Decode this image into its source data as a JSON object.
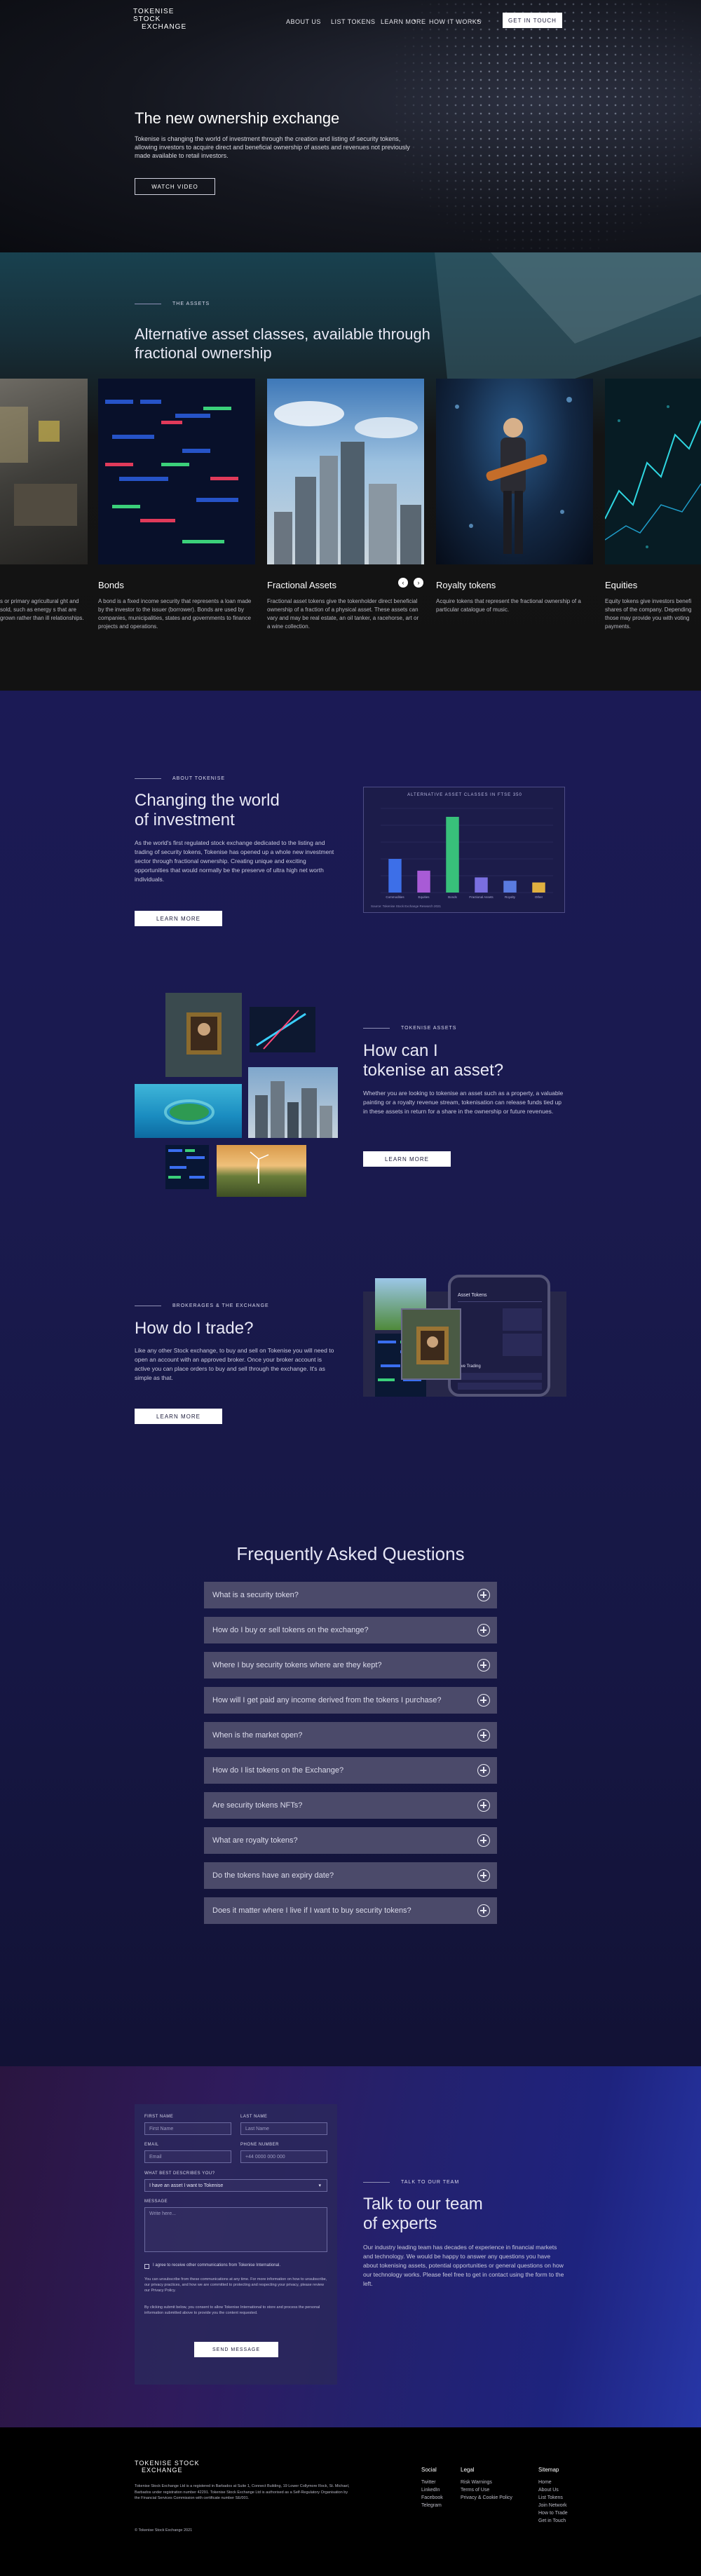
{
  "nav": {
    "logo_line1": "TOKENISE STOCK",
    "logo_line2": "EXCHANGE",
    "links": [
      "ABOUT US",
      "LIST TOKENS",
      "LEARN MORE",
      "HOW IT WORKS"
    ],
    "cta": "GET IN TOUCH"
  },
  "hero": {
    "title": "The new ownership exchange",
    "text": "Tokenise is changing the world of investment through the creation and listing of security tokens, allowing investors to acquire direct and beneficial ownership of assets and revenues not previously made available to retail investors.",
    "button": "WATCH VIDEO"
  },
  "assets": {
    "label": "THE ASSETS",
    "title": "Alternative asset classes, available through fractional ownership",
    "cards": [
      {
        "title": "",
        "desc": "s or primary agricultural ght and sold, such as energy s that are grown rather than ill relationships."
      },
      {
        "title": "Bonds",
        "desc": "A bond is a fixed income security that represents a loan made by the investor to the issuer (borrower). Bonds are used by companies, municipalities, states and governments to finance projects and operations."
      },
      {
        "title": "Fractional Assets",
        "desc": "Fractional asset tokens give the tokenholder direct beneficial ownership of a fraction of a physical asset. These assets can vary and may be real estate, an oil tanker, a racehorse, art or a wine collection."
      },
      {
        "title": "Royalty tokens",
        "desc": "Acquire tokens that represent the fractional ownership of a particular catalogue of music."
      },
      {
        "title": "Equities",
        "desc": "Equity tokens give investors benefi shares of the company. Depending those may provide you with voting payments."
      }
    ],
    "prev_icon": "chevron-left-icon",
    "next_icon": "chevron-right-icon"
  },
  "about": {
    "label": "ABOUT TOKENISE",
    "title_line1": "Changing the world",
    "title_line2": "of investment",
    "text": "As the world's first regulated stock exchange dedicated to the listing and trading of security tokens, Tokenise has opened up a whole new investment sector through fractional ownership. Creating unique and exciting opportunities that would normally be the preserve of ultra high net worth individuals.",
    "button": "LEARN MORE"
  },
  "chart_data": {
    "type": "bar",
    "title": "ALTERNATIVE ASSET CLASSES IN FTSE 350",
    "categories": [
      "Commodities",
      "Equities",
      "Bonds",
      "Fractional Assets",
      "Royalty",
      "Other"
    ],
    "values": [
      20,
      13,
      45,
      9,
      7,
      6
    ],
    "colors": [
      "#3d6fe8",
      "#a85bd6",
      "#38c07a",
      "#7a6fe0",
      "#5a7be0",
      "#e0b040"
    ],
    "ylim": [
      0,
      50
    ],
    "grid": true,
    "footnote": "Source: Tokenise Stock Exchange Research 2021"
  },
  "tokenise": {
    "label": "TOKENISE ASSETS",
    "title_line1": "How can I",
    "title_line2": "tokenise an asset?",
    "text": "Whether you are looking to tokenise an asset such as a property, a valuable painting or a royalty revenue stream, tokenisation can release funds tied up in these assets in return for a share in the ownership or future revenues.",
    "button": "LEARN MORE"
  },
  "trade": {
    "label": "BROKERAGES & THE EXCHANGE",
    "title": "How do I trade?",
    "text": "Like any other Stock exchange, to buy and sell on Tokenise you will need to open an account with an approved broker. Once your broker account is active you can place orders to buy and sell through the exchange. It's as simple as that.",
    "button": "LEARN MORE",
    "phone_header": "Asset Tokens",
    "phone_section": "Live Trading"
  },
  "faq": {
    "title": "Frequently Asked Questions",
    "items": [
      "What is a security token?",
      "How do I buy or sell tokens on the exchange?",
      "Where I buy security tokens where are they kept?",
      "How will I get paid any income derived from the tokens I purchase?",
      "When is the market open?",
      "How do I list tokens on the Exchange?",
      "Are security tokens NFTs?",
      "What are royalty tokens?",
      "Do the tokens have an expiry date?",
      "Does it matter where I live if I want to buy security tokens?"
    ]
  },
  "contact": {
    "first_name_label": "FIRST NAME",
    "first_name_ph": "First Name",
    "last_name_label": "LAST NAME",
    "last_name_ph": "Last Name",
    "email_label": "EMAIL",
    "email_ph": "Email",
    "phone_label": "PHONE NUMBER",
    "phone_ph": "+44 0000 000 000",
    "enquiry_label": "WHAT BEST DESCRIBES YOU?",
    "enquiry_value": "I have an asset I want to Tokenise",
    "message_label": "MESSAGE",
    "message_ph": "Write here...",
    "consent": "I agree to receive other communications from Tokenise International.",
    "privacy1": "You can unsubscribe from these communications at any time. For more information on how to unsubscribe, our privacy practices, and how we are committed to protecting and respecting your privacy, please review our Privacy Policy.",
    "privacy2": "By clicking submit below, you consent to allow Tokenise International to store and process the personal information submitted above to provide you the content requested.",
    "submit": "SEND MESSAGE",
    "label": "TALK TO OUR TEAM",
    "title_line1": "Talk to our team",
    "title_line2": "of experts",
    "text": "Our industry leading team has decades of experience in financial markets and technology. We would be happy to answer any questions you have about tokenising assets, potential opportunities or general questions on how our technology works. Please feel free to get in contact using the form to the left."
  },
  "footer": {
    "logo_line1": "TOKENISE STOCK",
    "logo_line2": "EXCHANGE",
    "legal_text": "Tokenise Stock Exchange Ltd is a registered in Barbados at Suite 1, Connect Building, 19 Lower Collymore Rock, St. Michael, Barbados under registration number 42291. Tokenise Stock Exchange Ltd is authorised as a Self-Regulatory Organisation by the Financial Services Commission with certificate number SE/001.",
    "copyright": "© Tokenise Stock Exchange 2021",
    "social_head": "Social",
    "social": [
      "Twitter",
      "LinkedIn",
      "Facebook",
      "Telegram"
    ],
    "legal_head": "Legal",
    "legal": [
      "Risk Warnings",
      "Terms of Use",
      "Privacy & Cookie Policy"
    ],
    "sitemap_head": "Sitemap",
    "sitemap": [
      "Home",
      "About Us",
      "List Tokens",
      "Join Network",
      "How to Trade",
      "Get in Touch"
    ]
  }
}
